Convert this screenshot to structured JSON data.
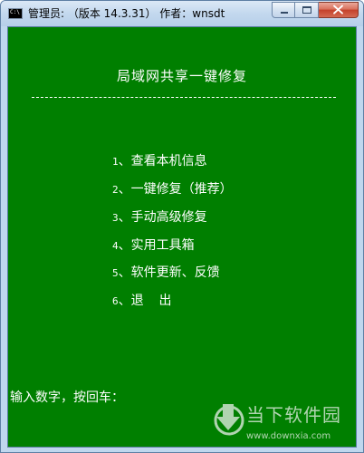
{
  "window": {
    "title": "管理员: （版本 14.3.31） 作者：wnsdt",
    "icon_text": "C:\\",
    "controls": [
      "minimize-icon",
      "maximize-icon",
      "close-icon"
    ]
  },
  "console": {
    "background": "#007f00",
    "foreground": "#ffffff",
    "title": "局域网共享一键修复",
    "separator": "----------------------------------------------------",
    "menu": [
      {
        "num": "1",
        "label": "、查看本机信息"
      },
      {
        "num": "2",
        "label": "、一键修复（推荐）"
      },
      {
        "num": "3",
        "label": "、手动高级修复"
      },
      {
        "num": "4",
        "label": "、实用工具箱"
      },
      {
        "num": "5",
        "label": "、软件更新、反馈"
      },
      {
        "num": "6",
        "label": "、退  出"
      }
    ],
    "prompt": "输入数字，按回车："
  },
  "watermark": {
    "name": "当下软件园",
    "url": "www.downxia.com"
  }
}
